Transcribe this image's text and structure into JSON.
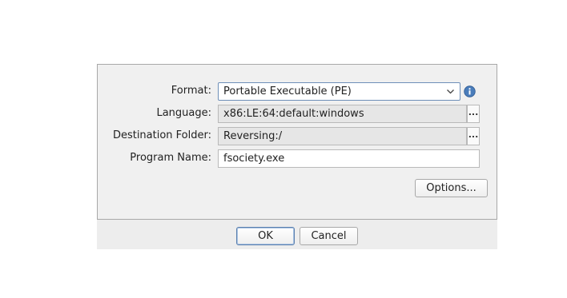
{
  "form": {
    "format_label": "Format:",
    "format_value": "Portable Executable (PE)",
    "language_label": "Language:",
    "language_value": "x86:LE:64:default:windows",
    "destination_label": "Destination Folder:",
    "destination_value": "Reversing:/",
    "program_name_label": "Program Name:",
    "program_name_value": "fsociety.exe",
    "browse_label": "...",
    "info_icon": "info-icon"
  },
  "buttons": {
    "options": "Options...",
    "ok": "OK",
    "cancel": "Cancel"
  },
  "colors": {
    "info_icon": "#4a7dbb",
    "default_button_border": "#5a7fae"
  }
}
